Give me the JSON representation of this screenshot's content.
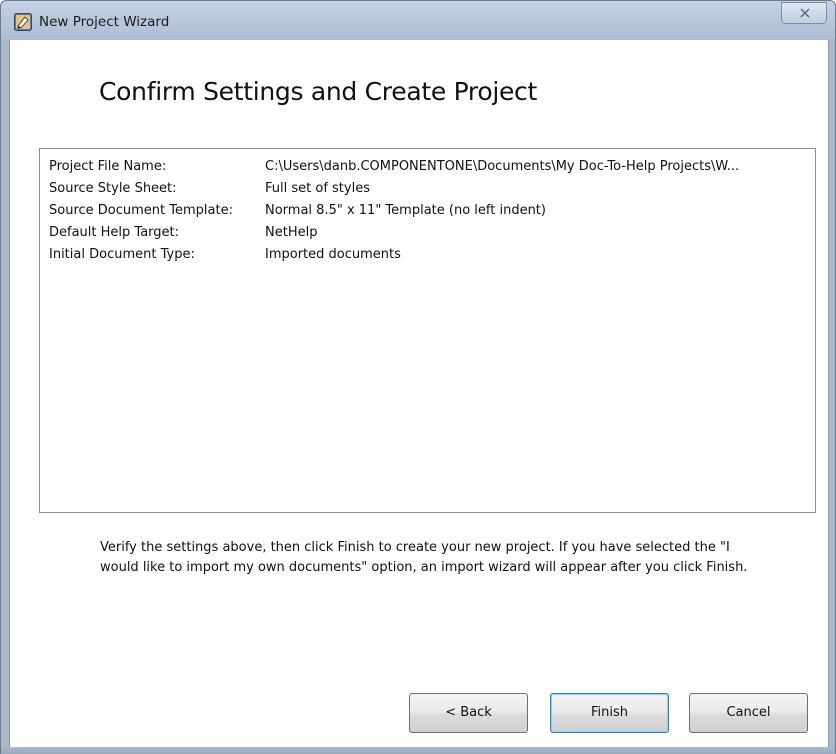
{
  "window": {
    "title": "New Project Wizard",
    "close_symbol": "close-icon"
  },
  "page": {
    "heading": "Confirm Settings and Create Project"
  },
  "settings": [
    {
      "label": "Project File Name:",
      "value": "C:\\Users\\danb.COMPONENTONE\\Documents\\My Doc-To-Help Projects\\W..."
    },
    {
      "label": "Source Style Sheet:",
      "value": "Full set of styles"
    },
    {
      "label": "Source Document Template:",
      "value": "Normal 8.5\" x 11\" Template (no left indent)"
    },
    {
      "label": "Default Help Target:",
      "value": "NetHelp"
    },
    {
      "label": "Initial Document Type:",
      "value": "Imported documents"
    }
  ],
  "info": {
    "text": "Verify the settings above, then click Finish to create your new project. If you have selected the \"I would like to import my own documents\" option, an import wizard will appear after you click Finish."
  },
  "buttons": {
    "back": "< Back",
    "finish": "Finish",
    "cancel": "Cancel"
  },
  "colors": {
    "titlebar": "#c3d2e3",
    "default_button_border": "#3c7fb1"
  }
}
